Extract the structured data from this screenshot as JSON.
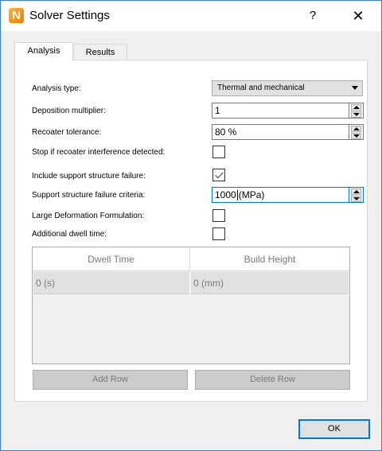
{
  "window": {
    "title": "Solver Settings",
    "app_icon_letter": "N",
    "help_label": "?",
    "close_label": "✕"
  },
  "tabs": [
    {
      "label": "Analysis",
      "active": true
    },
    {
      "label": "Results",
      "active": false
    }
  ],
  "analysis": {
    "analysis_type": {
      "label": "Analysis type:",
      "value": "Thermal and mechanical"
    },
    "deposition_multiplier": {
      "label": "Deposition multiplier:",
      "value": "1"
    },
    "recoater_tolerance": {
      "label": "Recoater tolerance:",
      "value": "80 %"
    },
    "stop_recoater": {
      "label": "Stop if recoater interference detected:",
      "checked": false
    },
    "include_support_failure": {
      "label": "Include support structure failure:",
      "checked": true
    },
    "support_failure_criteria": {
      "label": "Support structure failure criteria:",
      "value": "1000",
      "unit": "(MPa)"
    },
    "large_deformation": {
      "label": "Large Deformation Formulation:",
      "checked": false
    },
    "additional_dwell": {
      "label": "Additional dwell time:",
      "checked": false
    }
  },
  "dwell_table": {
    "headers": [
      "Dwell Time",
      "Build Height"
    ],
    "rows": [
      [
        "0 (s)",
        "0 (mm)"
      ]
    ]
  },
  "buttons": {
    "add_row": "Add Row",
    "delete_row": "Delete Row",
    "ok": "OK"
  }
}
